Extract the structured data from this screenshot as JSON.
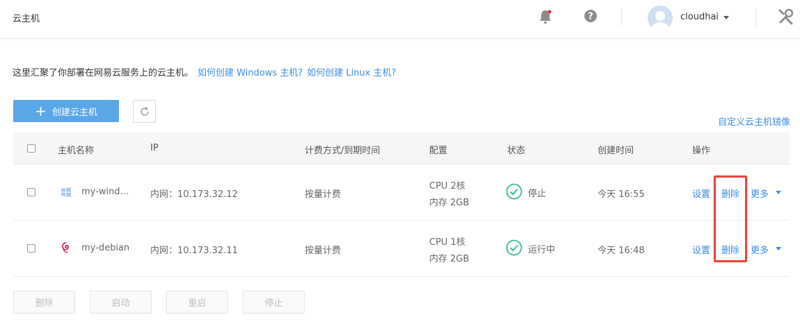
{
  "header": {
    "title": "云主机",
    "username": "cloudhai"
  },
  "intro": {
    "text": "这里汇聚了你部署在网易云服务上的云主机。",
    "link_windows": "如何创建 Windows 主机?",
    "link_linux": "如何创建 Linux 主机?"
  },
  "toolbar": {
    "create_label": "创建云主机",
    "custom_image_link": "自定义云主机镜像"
  },
  "table": {
    "headers": {
      "name": "主机名称",
      "ip": "IP",
      "billing": "计费方式/到期时间",
      "config": "配置",
      "status": "状态",
      "created": "创建时间",
      "actions": "操作"
    },
    "rows": [
      {
        "os_icon": "windows-icon",
        "name": "my-wind…",
        "ip": "内网：10.173.32.12",
        "billing": "按量计费",
        "cpu": "CPU 2核",
        "memory": "内存 2GB",
        "status": "停止",
        "created": "今天 16:55",
        "action_settings": "设置",
        "action_delete": "删除",
        "action_more": "更多"
      },
      {
        "os_icon": "debian-icon",
        "name": "my-debian",
        "ip": "内网：10.173.32.11",
        "billing": "按量计费",
        "cpu": "CPU 1核",
        "memory": "内存 2GB",
        "status": "运行中",
        "created": "今天 16:48",
        "action_settings": "设置",
        "action_delete": "删除",
        "action_more": "更多"
      }
    ]
  },
  "bulk_actions": {
    "delete": "删除",
    "start": "启动",
    "restart": "重启",
    "stop": "停止"
  },
  "colors": {
    "accent": "#3a8ee6",
    "primary_button": "#5aa7e8",
    "status_ok": "#2fbf8e",
    "highlight": "#e5473a"
  }
}
